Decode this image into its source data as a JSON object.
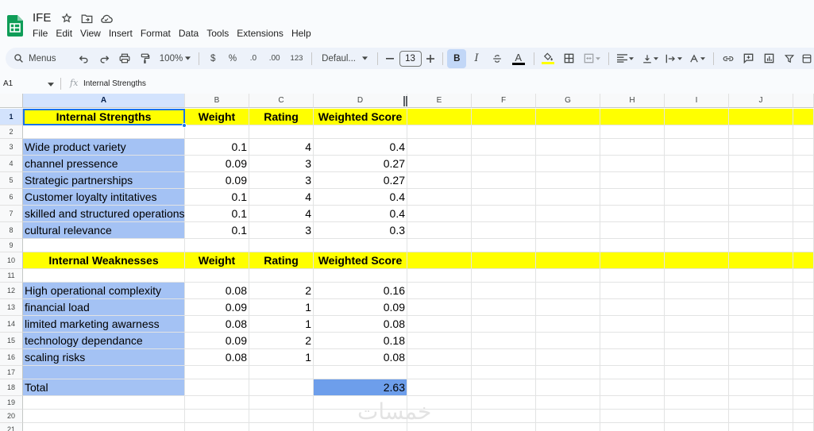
{
  "app": {
    "doc_title": "IFE",
    "menu": [
      "File",
      "Edit",
      "View",
      "Insert",
      "Format",
      "Data",
      "Tools",
      "Extensions",
      "Help"
    ]
  },
  "toolbar": {
    "search_label": "Menus",
    "zoom": "100%",
    "currency": "$",
    "percent": "%",
    "decimal_decrease": ".0",
    "decimal_increase": ".00",
    "number_format": "123",
    "font_family": "Defaul...",
    "font_size": "13",
    "bold": "B",
    "italic": "I",
    "text_color_letter": "A",
    "text_color_underline": "#000000",
    "highlight_underline": "#ffff00"
  },
  "formula_bar": {
    "cell_ref": "A1",
    "fx": "fx",
    "content": "Internal Strengths"
  },
  "columns": [
    "A",
    "B",
    "C",
    "D",
    "E",
    "F",
    "G",
    "H",
    "I",
    "J"
  ],
  "rows": [
    "1",
    "2",
    "3",
    "4",
    "5",
    "6",
    "7",
    "8",
    "9",
    "10",
    "11",
    "12",
    "13",
    "14",
    "15",
    "16",
    "17",
    "18",
    "19",
    "20",
    "21"
  ],
  "sheet": {
    "strengths_header": {
      "a": "Internal Strengths",
      "b": "Weight",
      "c": "Rating",
      "d": "Weighted Score"
    },
    "strengths": [
      {
        "factor": "Wide product variety",
        "weight": "0.1",
        "rating": "4",
        "score": "0.4"
      },
      {
        "factor": "channel pressence",
        "weight": "0.09",
        "rating": "3",
        "score": "0.27"
      },
      {
        "factor": "Strategic partnerships",
        "weight": "0.09",
        "rating": "3",
        "score": "0.27"
      },
      {
        "factor": "Customer loyalty intitatives",
        "weight": "0.1",
        "rating": "4",
        "score": "0.4"
      },
      {
        "factor": "skilled and structured operations",
        "weight": "0.1",
        "rating": "4",
        "score": "0.4"
      },
      {
        "factor": "cultural relevance",
        "weight": "0.1",
        "rating": "3",
        "score": "0.3"
      }
    ],
    "weaknesses_header": {
      "a": "Internal Weaknesses",
      "b": "Weight",
      "c": "Rating",
      "d": "Weighted Score"
    },
    "weaknesses": [
      {
        "factor": "High operational complexity",
        "weight": "0.08",
        "rating": "2",
        "score": "0.16"
      },
      {
        "factor": "financial load",
        "weight": "0.09",
        "rating": "1",
        "score": "0.09"
      },
      {
        "factor": "limited marketing awarness",
        "weight": "0.08",
        "rating": "1",
        "score": "0.08"
      },
      {
        "factor": "technology dependance",
        "weight": "0.09",
        "rating": "2",
        "score": "0.18"
      },
      {
        "factor": "scaling risks",
        "weight": "0.08",
        "rating": "1",
        "score": "0.08"
      }
    ],
    "total_label": "Total",
    "total_value": "2.63"
  },
  "colors": {
    "header_fill": "#ffff00",
    "factor_fill": "#a4c2f4",
    "total_fill": "#6d9eeb",
    "selection": "#1a73e8"
  },
  "watermark": "خمسات"
}
